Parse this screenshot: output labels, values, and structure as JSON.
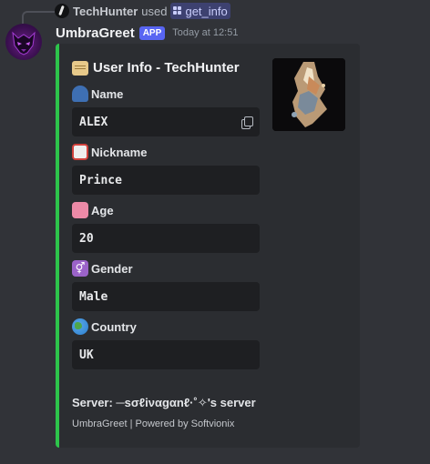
{
  "reply": {
    "username": "TechHunter",
    "used_text": "used",
    "command": "get_info"
  },
  "message": {
    "bot_name": "UmbraGreet",
    "badge": "APP",
    "timestamp": "Today at 12:51"
  },
  "embed": {
    "accent_color": "#2dc44b",
    "title": "User Info - TechHunter",
    "title_icon": "scroll-icon",
    "fields": [
      {
        "label": "Name",
        "value": "ALEX",
        "icon": "person-icon"
      },
      {
        "label": "Nickname",
        "value": "Prince",
        "icon": "book-icon"
      },
      {
        "label": "Age",
        "value": "20",
        "icon": "cake-icon"
      },
      {
        "label": "Gender",
        "value": "Male",
        "icon": "gender-icon"
      },
      {
        "label": "Country",
        "value": "UK",
        "icon": "globe-icon"
      }
    ],
    "server_line": "Server: ─sσℓiναgαnℓ·˚✧'s server",
    "footer": "UmbraGreet | Powered by Softvionix"
  },
  "colors": {
    "background": "#313338",
    "embed_background": "#2b2d31",
    "field_background": "#1e1f22",
    "app_badge": "#5865f2"
  }
}
